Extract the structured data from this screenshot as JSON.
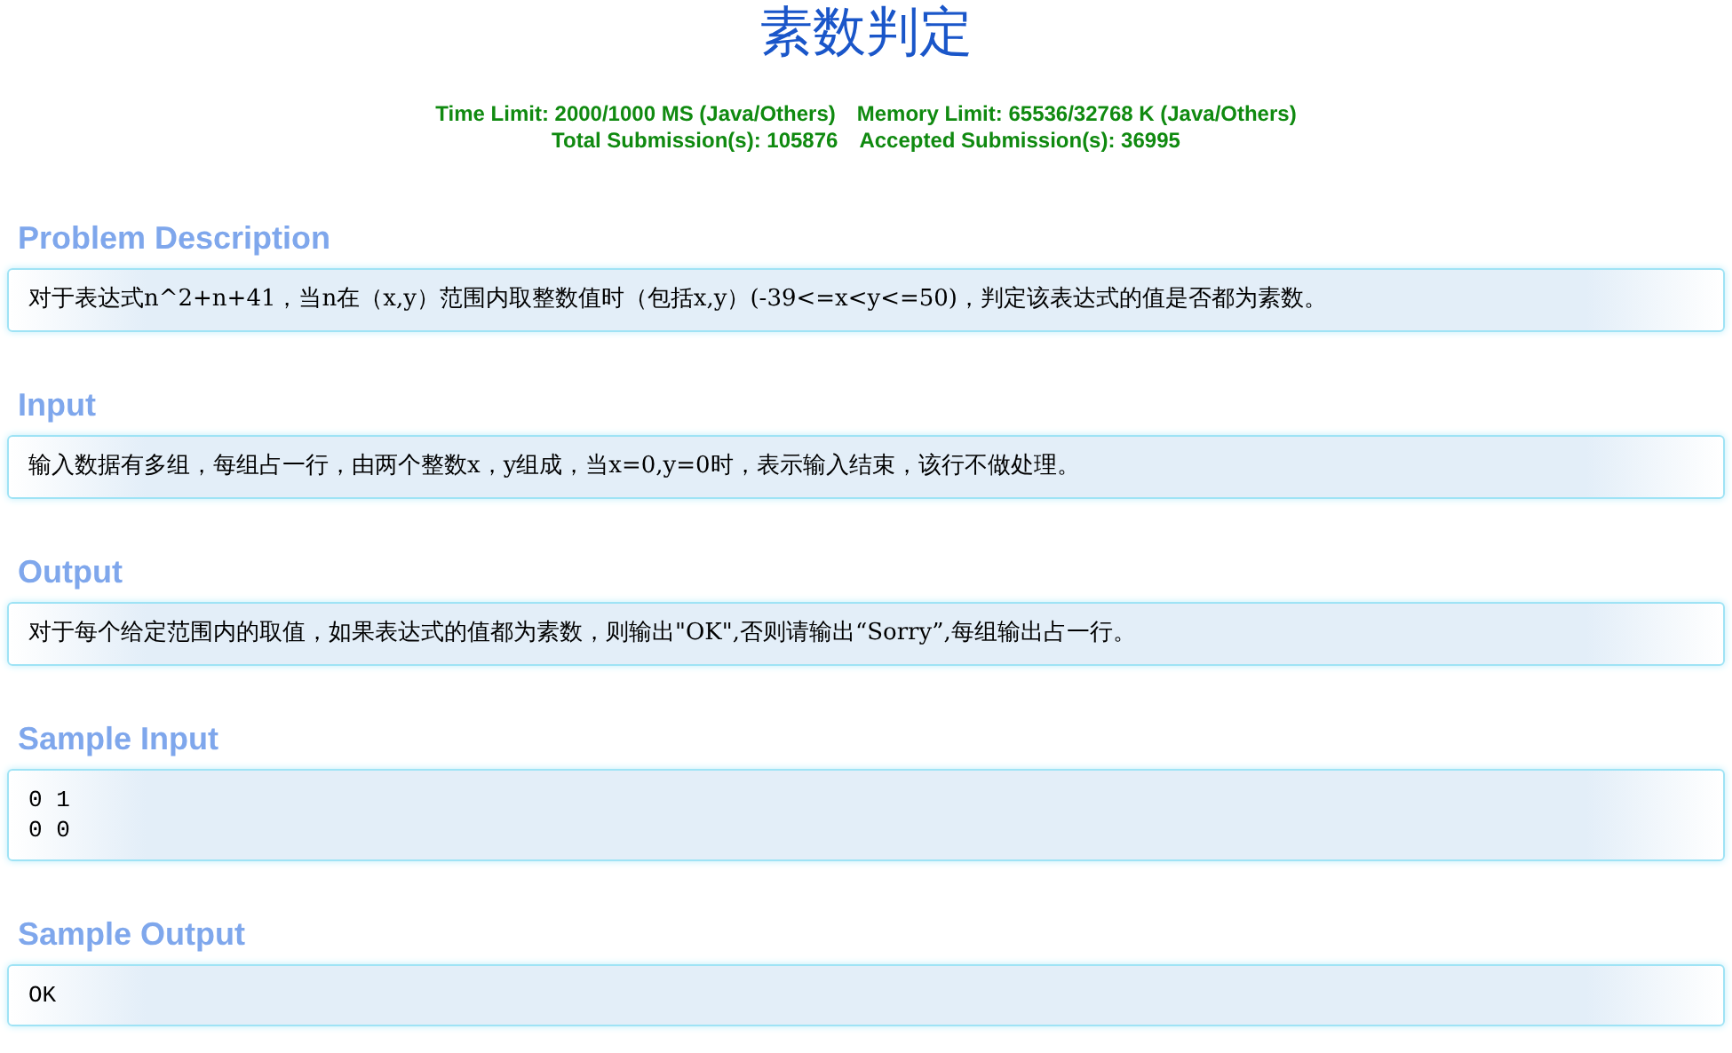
{
  "title": "素数判定",
  "limits": [
    {
      "label": "Time Limit: 2000/1000 MS (Java/Others)"
    },
    {
      "label": "Memory Limit: 65536/32768 K (Java/Others)"
    }
  ],
  "submissions": [
    {
      "label": "Total Submission(s): 105876"
    },
    {
      "label": "Accepted Submission(s): 36995"
    }
  ],
  "sections": [
    {
      "heading": "Problem Description",
      "kind": "text",
      "lines": [
        "对于表达式n^2+n+41，当n在（x,y）范围内取整数值时（包括x,y）(-39<=x<y<=50)，判定该表达式的值是否都为素数。"
      ]
    },
    {
      "heading": "Input",
      "kind": "text",
      "lines": [
        "输入数据有多组，每组占一行，由两个整数x，y组成，当x=0,y=0时，表示输入结束，该行不做处理。"
      ]
    },
    {
      "heading": "Output",
      "kind": "text",
      "lines": [
        "对于每个给定范围内的取值，如果表达式的值都为素数，则输出\"OK\",否则请输出“Sorry”,每组输出占一行。"
      ]
    },
    {
      "heading": "Sample Input",
      "kind": "code",
      "lines": [
        "0 1",
        "0 0"
      ]
    },
    {
      "heading": "Sample Output",
      "kind": "code",
      "lines": [
        "OK"
      ]
    }
  ]
}
